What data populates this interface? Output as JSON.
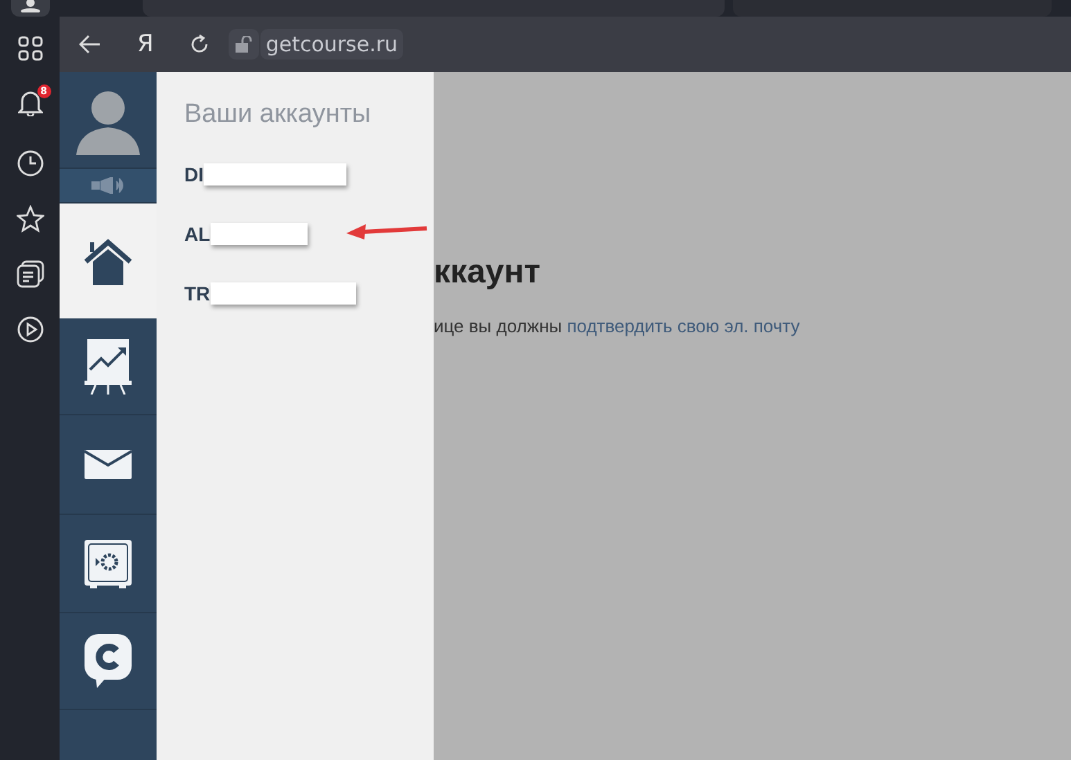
{
  "browser": {
    "notification_badge": "8",
    "logo": "Я",
    "url": "getcourse.ru"
  },
  "nav": [
    {
      "kind": "avatar",
      "selected": false
    },
    {
      "kind": "speaker",
      "selected": false
    },
    {
      "kind": "home",
      "selected": true
    },
    {
      "kind": "chart",
      "selected": false
    },
    {
      "kind": "mail",
      "selected": false
    },
    {
      "kind": "safe",
      "selected": false
    },
    {
      "kind": "chat",
      "selected": false
    }
  ],
  "accounts_panel": {
    "title": "Ваши аккаунты",
    "accounts": [
      {
        "label": "DI"
      },
      {
        "label": "AL"
      },
      {
        "label": "TR"
      }
    ]
  },
  "page": {
    "heading": "ккаунт",
    "text": "ице вы должны",
    "link": "подтвердить свою эл. почту"
  }
}
